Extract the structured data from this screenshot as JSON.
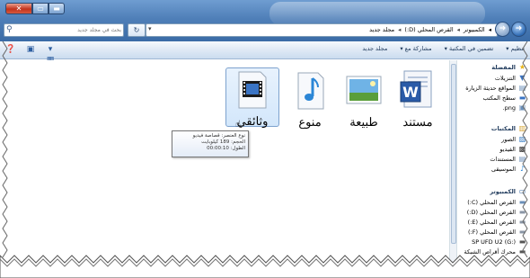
{
  "window": {
    "close_label": "✕",
    "maximize_label": "▭",
    "minimize_label": "▬"
  },
  "address": {
    "breadcrumbs": [
      "الكمبيوتر",
      "القرص المحلي (D:)",
      "مجلد جديد"
    ],
    "search_placeholder": "بحث في مجلد جديد"
  },
  "toolbar": {
    "organize": "تنظيم ▾",
    "include_in_library": "تضمين في المكتبة ▾",
    "share_with": "مشاركة مع ▾",
    "new_folder": "مجلد جديد"
  },
  "navpane": {
    "favorites": "المفضلة",
    "favorites_items": [
      "التنزيلات",
      "المواقع حديثة الزيارة",
      "سطح المكتب",
      "png."
    ],
    "libraries": "المكتبات",
    "libraries_items": [
      "الصور",
      "الفيديو",
      "المستندات",
      "الموسيقى"
    ],
    "computer": "الكمبيوتر",
    "computer_items": [
      "القرص المحلي (C:)",
      "القرص المحلي (D:)",
      "القرص المحلي (E:)",
      "القرص المحلي (F:)",
      "SP UFD U2 (G:)",
      "محرك أقراص الشبكة"
    ]
  },
  "files": [
    {
      "label": "مستند",
      "icon": "word-document-icon"
    },
    {
      "label": "طبيعة",
      "icon": "image-file-icon"
    },
    {
      "label": "منوع",
      "icon": "music-file-icon"
    },
    {
      "label": "وثائقي",
      "icon": "video-file-icon"
    }
  ],
  "tooltip": {
    "line1": "نوع العنصر: قصاصة فيديو",
    "line2": "الحجم: 189 كيلوبايت",
    "line3": "الطول: 00:00:10"
  },
  "colors": {
    "titlebar": "#4f7fb8",
    "selection": "#d3e7fb",
    "toolbar": "#dfe9f5"
  }
}
